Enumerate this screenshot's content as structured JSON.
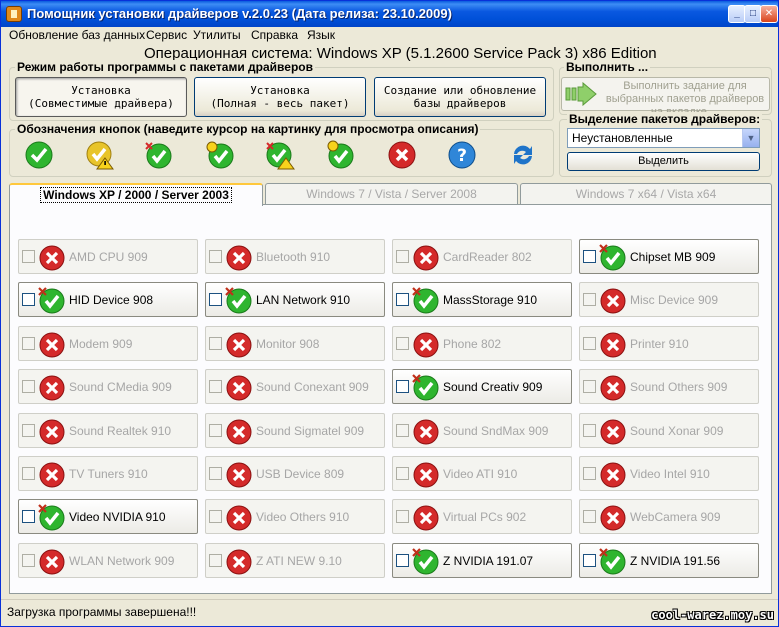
{
  "window": {
    "title": "Помощник установки драйверов v.2.0.23 (Дата релиза: 23.10.2009)"
  },
  "menu": [
    "Обновление баз данных",
    "Сервис",
    "Утилиты",
    "Справка",
    "Язык"
  ],
  "os_info": "Операционная система: Windows XP  (5.1.2600 Service Pack 3) x86 Edition",
  "mode_group": {
    "title": "Режим работы программы с пакетами драйверов",
    "buttons": [
      "Установка\n(Совместимые драйвера)",
      "Установка\n(Полная - весь пакет)",
      "Создание или обновление\nбазы драйверов"
    ]
  },
  "run_group": {
    "title": "Выполнить ...",
    "button_text": "Выполнить задание для выбранных пакетов драйверов на вкладке ..."
  },
  "legend_group": {
    "title": "Обозначения кнопок (наведите курсор на картинку для просмотра описания)",
    "icons": [
      "check-icon",
      "check-warning-icon",
      "check-new-icon",
      "check-info-icon",
      "check-new-warning-icon",
      "check-info-alt-icon",
      "error-icon",
      "help-icon",
      "refresh-icon"
    ]
  },
  "selection_group": {
    "title": "Выделение пакетов драйверов:",
    "selected_option": "Неустановленные",
    "select_button": "Выделить"
  },
  "tabs": [
    "Windows XP / 2000 / Server 2003",
    "Windows 7 / Vista / Server 2008",
    "Windows 7 x64 / Vista x64"
  ],
  "drivers": [
    {
      "label": "AMD CPU 909",
      "state": "off"
    },
    {
      "label": "Bluetooth 910",
      "state": "off"
    },
    {
      "label": "CardReader 802",
      "state": "off"
    },
    {
      "label": "Chipset MB 909",
      "state": "on"
    },
    {
      "label": "HID Device 908",
      "state": "on"
    },
    {
      "label": "LAN Network 910",
      "state": "on"
    },
    {
      "label": "MassStorage 910",
      "state": "on"
    },
    {
      "label": "Misc Device 909",
      "state": "off"
    },
    {
      "label": "Modem 909",
      "state": "off"
    },
    {
      "label": "Monitor 908",
      "state": "off"
    },
    {
      "label": "Phone 802",
      "state": "off"
    },
    {
      "label": "Printer 910",
      "state": "off"
    },
    {
      "label": "Sound CMedia 909",
      "state": "off"
    },
    {
      "label": "Sound Conexant 909",
      "state": "off"
    },
    {
      "label": "Sound Creativ 909",
      "state": "on"
    },
    {
      "label": "Sound Others 909",
      "state": "off"
    },
    {
      "label": "Sound Realtek 910",
      "state": "off"
    },
    {
      "label": "Sound Sigmatel 909",
      "state": "off"
    },
    {
      "label": "Sound SndMax 909",
      "state": "off"
    },
    {
      "label": "Sound Xonar 909",
      "state": "off"
    },
    {
      "label": "TV Tuners 910",
      "state": "off"
    },
    {
      "label": "USB Device 809",
      "state": "off"
    },
    {
      "label": "Video ATI 910",
      "state": "off"
    },
    {
      "label": "Video Intel 910",
      "state": "off"
    },
    {
      "label": "Video NVIDIA 910",
      "state": "on"
    },
    {
      "label": "Video Others 910",
      "state": "off"
    },
    {
      "label": "Virtual PCs 902",
      "state": "off"
    },
    {
      "label": "WebCamera 909",
      "state": "off"
    },
    {
      "label": "WLAN Network 909",
      "state": "off"
    },
    {
      "label": "Z ATI NEW 9.10",
      "state": "off"
    },
    {
      "label": "Z NVIDIA 191.07",
      "state": "on"
    },
    {
      "label": "Z NVIDIA 191.56",
      "state": "on"
    }
  ],
  "status": "Загрузка программы завершена!!!",
  "watermark": "cool-warez.moy.su",
  "colors": {
    "ok_green": "#2fb52f",
    "error_red": "#d42a2a",
    "help_blue": "#2f86d8",
    "titlebar_blue": "#0a58e0"
  }
}
